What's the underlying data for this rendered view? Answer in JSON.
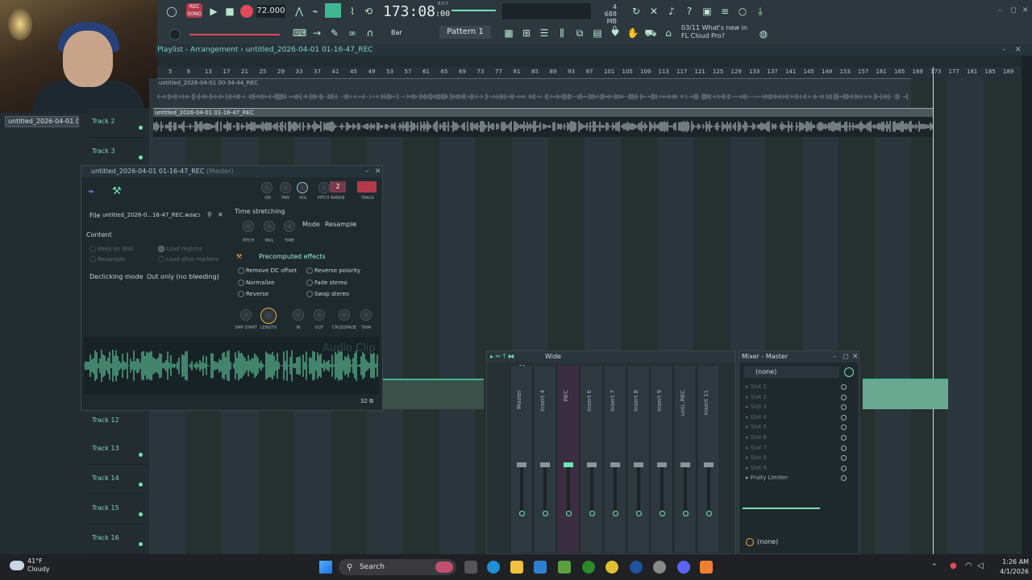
{
  "webcam": {},
  "sidebar": {
    "recording_item": "untitled_2026-04-01 01-..."
  },
  "toolbar": {
    "rec_label": "REC",
    "song_label": "SONG",
    "tempo": "72.000",
    "time_main": "173:08",
    "time_sub": ":00",
    "time_unit": "B:S:T",
    "mem_mb": "688 MB",
    "mem_sub": "0",
    "mem_top": "4",
    "snap": "Bar",
    "pattern": "Pattern 1",
    "news_date": "03/11",
    "news_text": "What's new in FL Cloud Pro?",
    "accent": "#6fe6b3"
  },
  "playlist": {
    "title": "Playlist - Arrangement",
    "breadcrumb": "untitled_2026-04-01 01-16-47_REC",
    "ruler": [
      "5",
      "9",
      "13",
      "17",
      "21",
      "25",
      "29",
      "33",
      "37",
      "41",
      "45",
      "49",
      "53",
      "57",
      "61",
      "65",
      "69",
      "73",
      "77",
      "81",
      "85",
      "89",
      "93",
      "97",
      "101",
      "105",
      "109",
      "113",
      "117",
      "121",
      "125",
      "129",
      "133",
      "137",
      "141",
      "145",
      "149",
      "153",
      "157",
      "161",
      "165",
      "169",
      "173",
      "177",
      "181",
      "185",
      "189"
    ],
    "tracks": [
      {
        "label": "Track 2"
      },
      {
        "label": "Track 3"
      },
      {
        "label": "Track 12"
      },
      {
        "label": "Track 13"
      },
      {
        "label": "Track 14"
      },
      {
        "label": "Track 15"
      },
      {
        "label": "Track 16"
      }
    ],
    "clip1": "untitled_2026-04-01 00-34-44_REC",
    "clip2": "untitled_2026-04-01 01-16-47_REC"
  },
  "sampler": {
    "title": "untitled_2026-04-01 01-16-47_REC",
    "title_suffix": "(Master)",
    "knobs": [
      "ON",
      "PAN",
      "VOL",
      "PITCH",
      "RANGE",
      "TRACK"
    ],
    "range_value": "2",
    "file_label": "File",
    "file_name": "untitled_2026-0...16-47_REC.wav",
    "content_label": "Content",
    "keep_on_disk": "Keep on disk",
    "resample": "Resample",
    "load_regions": "Load regions",
    "load_slice_markers": "Load slice markers",
    "declicking_label": "Declicking mode",
    "declicking_value": "Out only (no bleeding)",
    "time_stretching": "Time stretching",
    "ts_knobs": [
      "PITCH",
      "MUL",
      "TIME"
    ],
    "mode_label": "Mode",
    "mode_value": "Resample",
    "precomputed": "Precomputed effects",
    "fx": [
      "Remove DC offset",
      "Normalize",
      "Reverse",
      "Reverse polarity",
      "Fade stereo",
      "Swap stereo"
    ],
    "bottom_knobs": [
      "SMP START",
      "LENGTH",
      "IN",
      "OUT",
      "CROSSFADE",
      "TRIM"
    ],
    "audio_clip": "Audio Clip",
    "bottom_num": "32"
  },
  "mixer": {
    "preset": "Wide",
    "strips": [
      "Master",
      "Insert 4",
      "REC",
      "Insert 6",
      "Insert 7",
      "Insert 8",
      "Insert 9",
      "unti..REC",
      "Insert 11"
    ],
    "m_label": "M"
  },
  "mixer_master": {
    "title": "Mixer - Master",
    "input": "(none)",
    "slots": [
      "Slot 1",
      "Slot 2",
      "Slot 3",
      "Slot 4",
      "Slot 5",
      "Slot 6",
      "Slot 7",
      "Slot 8",
      "Slot 9"
    ],
    "plugin": "Fruity Limiter",
    "output": "(none)"
  },
  "taskbar": {
    "temp": "41°F",
    "condition": "Cloudy",
    "search": "Search",
    "time": "1:26 AM",
    "date": "4/1/2026"
  }
}
